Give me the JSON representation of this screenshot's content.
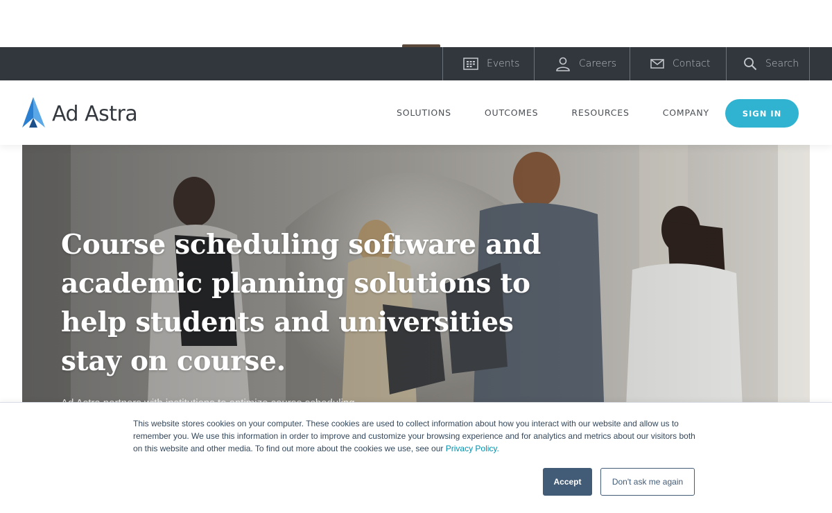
{
  "utility_nav": {
    "items": [
      {
        "label": "Events",
        "icon": "calendar-icon"
      },
      {
        "label": "Careers",
        "icon": "person-icon"
      },
      {
        "label": "Contact",
        "icon": "envelope-icon"
      },
      {
        "label": "Search",
        "icon": "search-icon"
      }
    ]
  },
  "header": {
    "logo_text": "Ad Astra",
    "nav": [
      "SOLUTIONS",
      "OUTCOMES",
      "RESOURCES",
      "COMPANY"
    ],
    "sign_in_label": "SIGN IN"
  },
  "hero": {
    "heading": "Course scheduling software and academic planning solutions to help students and universities stay on course.",
    "subtext": "Ad Astra partners with institutions to optimize course scheduling"
  },
  "cookie_banner": {
    "text": "This website stores cookies on your computer. These cookies are used to collect information about how you interact with our website and allow us to remember you. We use this information in order to improve and customize your browsing experience and for analytics and metrics about our visitors both on this website and other media. To find out more about the cookies we use, see our",
    "link_text": "Privacy Policy.",
    "accept_label": "Accept",
    "decline_label": "Don't ask me again"
  },
  "colors": {
    "utility_bar": "#32373e",
    "accent": "#2fb3d1",
    "cookie_button": "#425b76",
    "logo_blue": "#2a7fd0"
  }
}
